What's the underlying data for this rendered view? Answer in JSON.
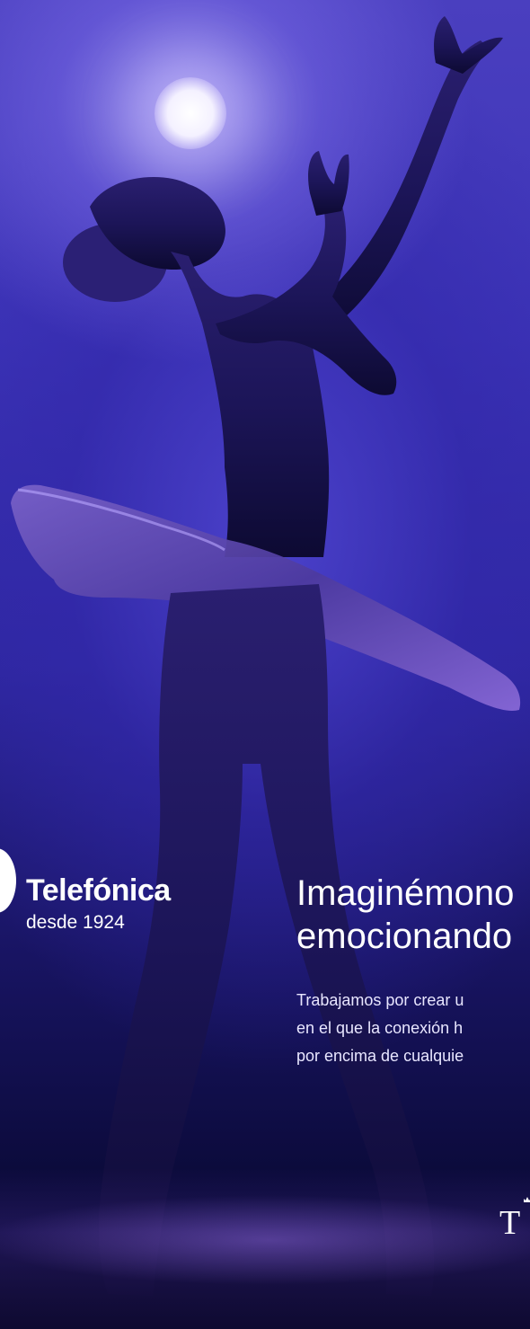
{
  "hero": {
    "image_description_icon": "ballerina-silhouette-icon"
  },
  "brand": {
    "name": "Telefónica",
    "since": "desde 1924",
    "mark_icon": "telefonica-mark-icon"
  },
  "headline": {
    "line1": "Imaginémono",
    "line2": "emocionando"
  },
  "body": {
    "line1": "Trabajamos por crear u",
    "line2": "en el que la conexión h",
    "line3": "por encima de cualquie"
  },
  "seal": {
    "letter": "T",
    "icon": "crown-icon"
  },
  "colors": {
    "background_top": "#4a3fbf",
    "background_bottom": "#080728",
    "text": "#ffffff"
  }
}
